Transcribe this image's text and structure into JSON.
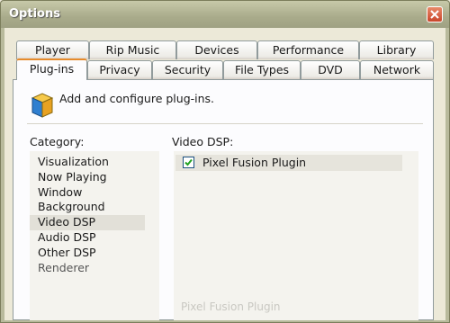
{
  "window": {
    "title": "Options"
  },
  "tabs": {
    "row1": [
      "Player",
      "Rip Music",
      "Devices",
      "Performance",
      "Library"
    ],
    "row2": [
      "Plug-ins",
      "Privacy",
      "Security",
      "File Types",
      "DVD",
      "Network"
    ],
    "active": "Plug-ins"
  },
  "plugins": {
    "header": "Add and configure plug-ins.",
    "category_label": "Category:",
    "categories": [
      "Visualization",
      "Now Playing",
      "Window",
      "Background",
      "Video DSP",
      "Audio DSP",
      "Other DSP",
      "Renderer"
    ],
    "selected_category": "Video DSP",
    "list_label": "Video DSP:",
    "items": [
      {
        "name": "Pixel Fusion Plugin",
        "checked": true
      }
    ],
    "faded_caption": "Pixel Fusion Plugin"
  },
  "colors": {
    "accent_tab": "#e68b2c",
    "title_bar": "#a9ab8b"
  }
}
